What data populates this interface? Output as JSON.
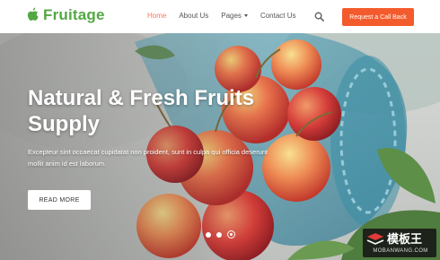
{
  "brand": {
    "name": "Fruitage",
    "color": "#53a843"
  },
  "nav": {
    "items": [
      {
        "label": "Home",
        "active": true
      },
      {
        "label": "About Us",
        "active": false
      },
      {
        "label": "Pages",
        "active": false,
        "dropdown": true
      },
      {
        "label": "Contact Us",
        "active": false
      }
    ],
    "active_color": "#f47a5b"
  },
  "header": {
    "search_icon": "search-icon",
    "cta_label": "Request a Call Back",
    "cta_color": "#f35b2d"
  },
  "hero": {
    "title_line1": "Natural & Fresh Fruits",
    "title_line2": "Supply",
    "text_line1": "Excepteur sint occaecat cupidatat non proident, sunt in culpa qui officia deserunt",
    "text_line2": "mollit anim id est laborum.",
    "button_label": "READ MORE"
  },
  "slider": {
    "slides": 3,
    "active_slide": 3
  },
  "watermark": {
    "cn": "模板王",
    "en": "MOBANWANG.COM"
  }
}
